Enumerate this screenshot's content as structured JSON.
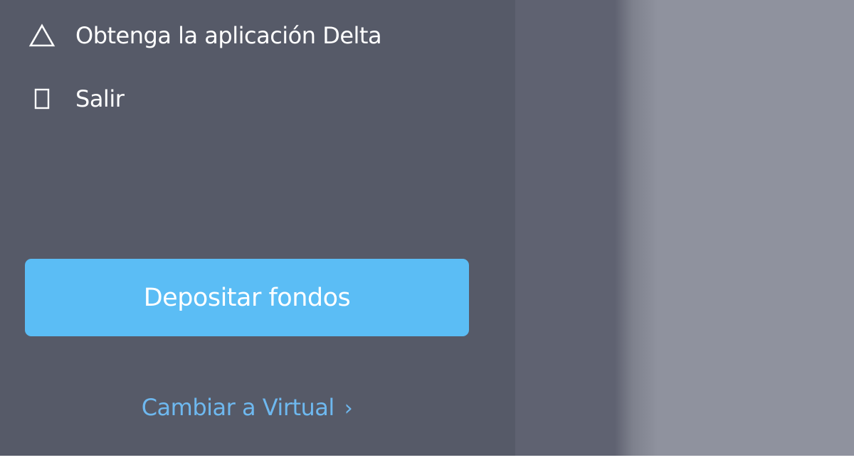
{
  "sidebar": {
    "items": [
      {
        "label": "Obtenga la aplicación Delta",
        "icon": "triangle-icon"
      },
      {
        "label": "Salir",
        "icon": "door-icon"
      }
    ],
    "deposit_button": "Depositar fondos",
    "switch_link": {
      "label": "Cambiar a Virtual",
      "chevron": "›"
    }
  },
  "colors": {
    "sidebar_bg": "#565a68",
    "overlay_bg": "#8f929e",
    "button_bg": "#5bbdf5",
    "link_text": "#6eb8ef",
    "text": "#ffffff"
  }
}
